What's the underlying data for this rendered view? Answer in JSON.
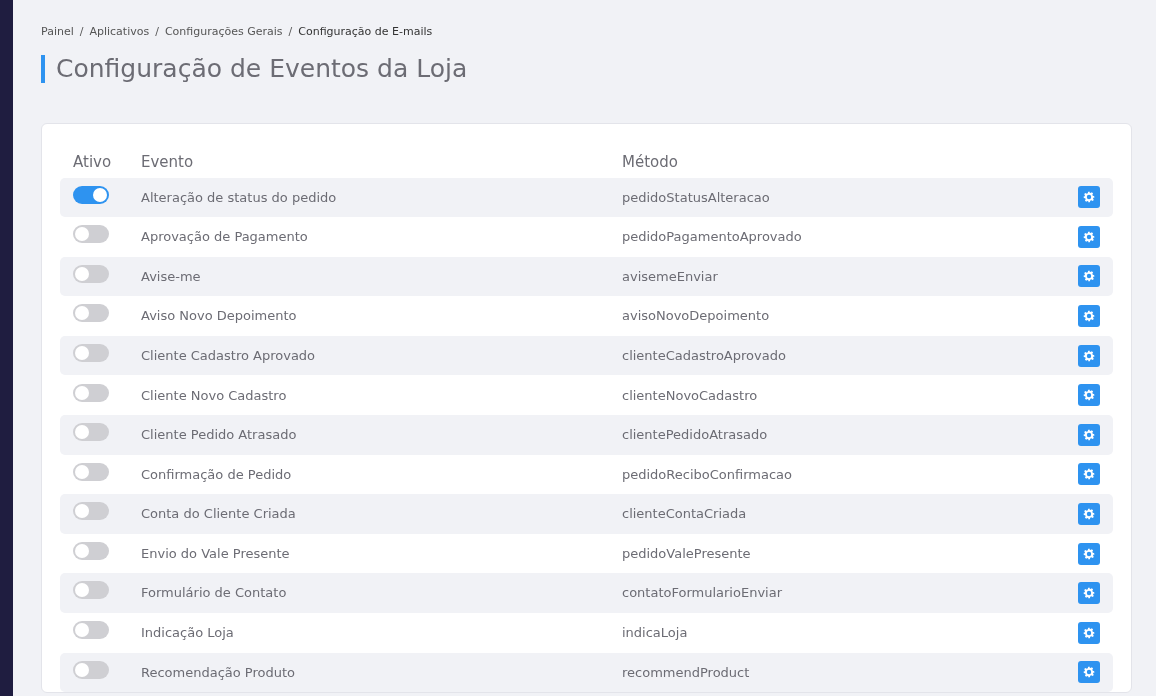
{
  "breadcrumb": [
    {
      "label": "Painel",
      "current": false
    },
    {
      "separator": "/",
      "label": "Aplicativos",
      "current": false
    },
    {
      "separator": "/",
      "label": "Configurações Gerais",
      "current": false
    },
    {
      "separator": "/",
      "label": "Configuração de E-mails",
      "current": true
    }
  ],
  "title": "Configuração de Eventos da Loja",
  "table": {
    "columns": [
      "Ativo",
      "Evento",
      "Método"
    ],
    "rows": [
      {
        "active": true,
        "event": "Alteração de status do pedido",
        "method": "pedidoStatusAlteracao"
      },
      {
        "active": false,
        "event": "Aprovação de Pagamento",
        "method": "pedidoPagamentoAprovado"
      },
      {
        "active": false,
        "event": "Avise-me",
        "method": "avisemeEnviar"
      },
      {
        "active": false,
        "event": "Aviso Novo Depoimento",
        "method": "avisoNovoDepoimento"
      },
      {
        "active": false,
        "event": "Cliente Cadastro Aprovado",
        "method": "clienteCadastroAprovado"
      },
      {
        "active": false,
        "event": "Cliente Novo Cadastro",
        "method": "clienteNovoCadastro"
      },
      {
        "active": false,
        "event": "Cliente Pedido Atrasado",
        "method": "clientePedidoAtrasado"
      },
      {
        "active": false,
        "event": "Confirmação de Pedido",
        "method": "pedidoReciboConfirmacao"
      },
      {
        "active": false,
        "event": "Conta do Cliente Criada",
        "method": "clienteContaCriada"
      },
      {
        "active": false,
        "event": "Envio do Vale Presente",
        "method": "pedidoValePresente"
      },
      {
        "active": false,
        "event": "Formulário de Contato",
        "method": "contatoFormularioEnviar"
      },
      {
        "active": false,
        "event": "Indicação Loja",
        "method": "indicaLoja"
      },
      {
        "active": false,
        "event": "Recomendação Produto",
        "method": "recommendProduct"
      }
    ]
  }
}
